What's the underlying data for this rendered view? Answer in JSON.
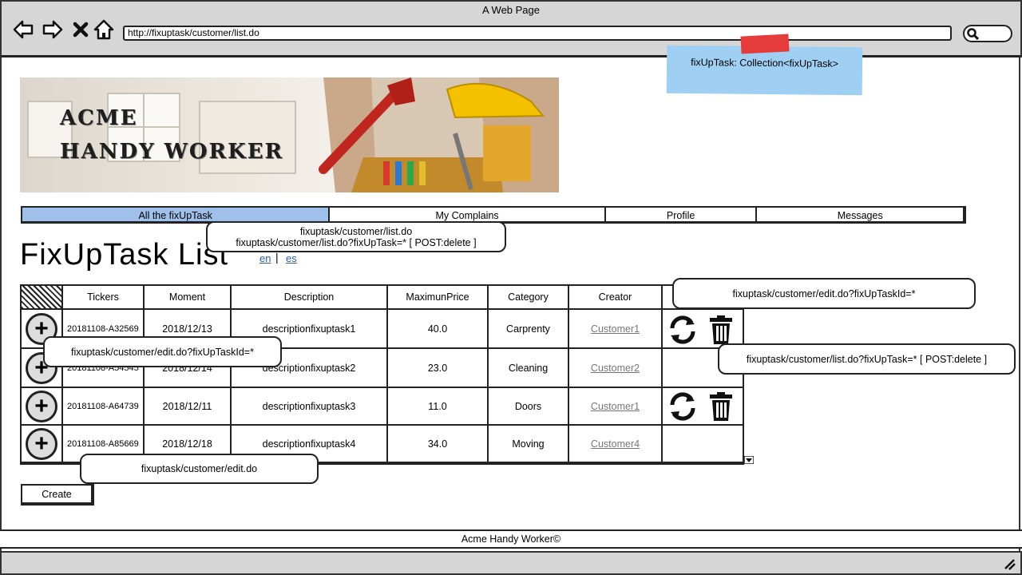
{
  "window": {
    "title": "A Web Page"
  },
  "browser": {
    "url": "http://fixuptask/customer/list.do"
  },
  "sticky_note": {
    "text": "fixUpTask: Collection<fixUpTask>"
  },
  "banner": {
    "line1": "ACME",
    "line2": "HANDY WORKER"
  },
  "tabs": [
    {
      "label": "All the fixUpTask",
      "active": true
    },
    {
      "label": "My Complains",
      "active": false
    },
    {
      "label": "Profile",
      "active": false
    },
    {
      "label": "Messages",
      "active": false
    }
  ],
  "page": {
    "title": "FixUpTask List",
    "lang_en": "en",
    "lang_es": "es"
  },
  "table": {
    "headers": [
      "Tickers",
      "Moment",
      "Description",
      "MaximunPrice",
      "Category",
      "Creator"
    ],
    "rows": [
      {
        "ticker": "20181108-A32569",
        "moment": "2018/12/13",
        "description": "descriptionfixuptask1",
        "price": "40.0",
        "category": "Carprenty",
        "creator": "Customer1",
        "actions": true
      },
      {
        "ticker": "20181108-A54545",
        "moment": "2018/12/14",
        "description": "descriptionfixuptask2",
        "price": "23.0",
        "category": "Cleaning",
        "creator": "Customer2",
        "actions": false
      },
      {
        "ticker": "20181108-A64739",
        "moment": "2018/12/11",
        "description": "descriptionfixuptask3",
        "price": "11.0",
        "category": "Doors",
        "creator": "Customer1",
        "actions": true
      },
      {
        "ticker": "20181108-A85669",
        "moment": "2018/12/18",
        "description": "descriptionfixuptask4",
        "price": "34.0",
        "category": "Moving",
        "creator": "Customer4",
        "actions": false
      }
    ]
  },
  "callouts": {
    "tab_line1": "fixuptask/customer/list.do",
    "tab_line2": "fixuptask/customer/list.do?fixUpTask=* [ POST:delete ]",
    "edit_header": "fixuptask/customer/edit.do?fixUpTaskId=*",
    "edit_row": "fixuptask/customer/edit.do?fixUpTaskId=*",
    "delete_row": "fixuptask/customer/list.do?fixUpTask=* [ POST:delete ]",
    "create": "fixuptask/customer/edit.do"
  },
  "buttons": {
    "create": "Create"
  },
  "footer": {
    "text": "Acme Handy Worker©"
  },
  "colors": {
    "active_tab": "#9ec0ea",
    "sticky": "#9fd0f4",
    "tape": "#e53b3b",
    "link": "#2a5dab"
  }
}
